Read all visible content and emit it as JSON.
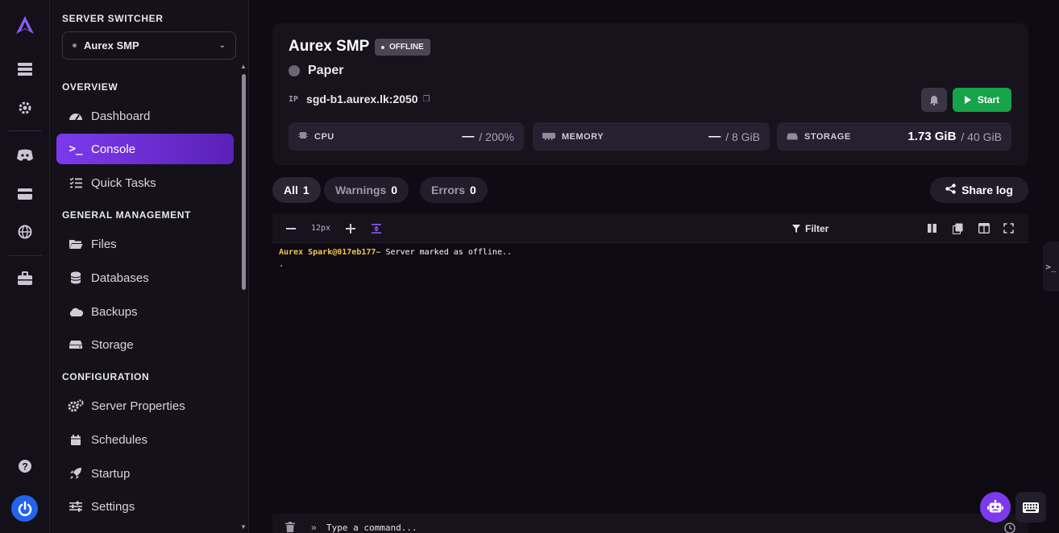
{
  "sidebar": {
    "switcher_title": "SERVER SWITCHER",
    "selected_server": "Aurex SMP",
    "sections": {
      "overview": "OVERVIEW",
      "general": "GENERAL MANAGEMENT",
      "configuration": "CONFIGURATION"
    },
    "items": {
      "dashboard": "Dashboard",
      "console": "Console",
      "quick_tasks": "Quick Tasks",
      "files": "Files",
      "databases": "Databases",
      "backups": "Backups",
      "storage": "Storage",
      "server_properties": "Server Properties",
      "schedules": "Schedules",
      "startup": "Startup",
      "settings": "Settings"
    },
    "active_item": "console"
  },
  "server": {
    "name": "Aurex SMP",
    "status": "OFFLINE",
    "software": "Paper",
    "ip_label": "IP",
    "address": "sgd-b1.aurex.lk:2050",
    "start_label": "Start"
  },
  "stats": {
    "cpu": {
      "label": "CPU",
      "value": "—",
      "max": "/ 200%"
    },
    "memory": {
      "label": "MEMORY",
      "value": "—",
      "max": "/ 8 GiB"
    },
    "storage": {
      "label": "STORAGE",
      "value": "1.73 GiB",
      "max": "/ 40 GiB"
    }
  },
  "log_tabs": {
    "all": {
      "label": "All",
      "count": "1"
    },
    "warnings": {
      "label": "Warnings",
      "count": "0"
    },
    "errors": {
      "label": "Errors",
      "count": "0"
    },
    "share": "Share log"
  },
  "console": {
    "font_size": "12px",
    "filter_label": "Filter",
    "lines": [
      {
        "prompt": "Aurex Spark@017eb177~",
        "text": "Server marked as offline.."
      },
      {
        "prompt": "",
        "text": "."
      }
    ],
    "command_placeholder": "Type a command...",
    "side_toggle": ">_"
  },
  "colors": {
    "accent": "#7c3aed",
    "start": "#16a34a",
    "prompt": "#f5c451",
    "power": "#2563eb"
  }
}
